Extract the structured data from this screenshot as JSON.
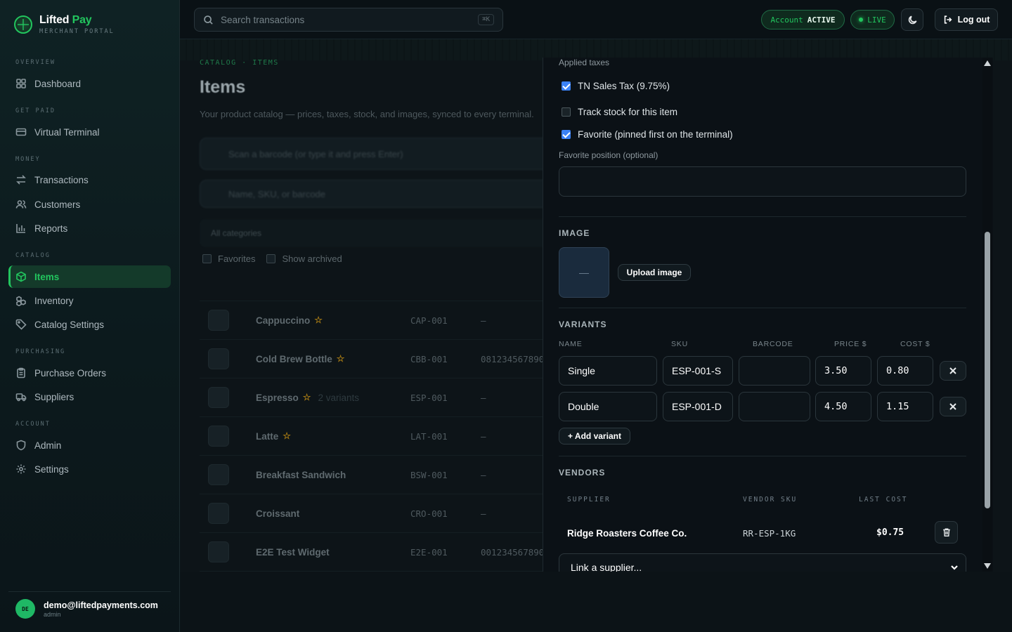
{
  "brand": {
    "name_a": "Lifted",
    "name_b": "Pay",
    "subtitle": "MERCHANT PORTAL"
  },
  "nav": {
    "overview_label": "OVERVIEW",
    "dashboard": "Dashboard",
    "getpaid_label": "GET PAID",
    "virtual_terminal": "Virtual Terminal",
    "money_label": "MONEY",
    "transactions": "Transactions",
    "customers": "Customers",
    "reports": "Reports",
    "catalog_label": "CATALOG",
    "items": "Items",
    "inventory": "Inventory",
    "catalog_settings": "Catalog Settings",
    "purchasing_label": "PURCHASING",
    "purchase_orders": "Purchase Orders",
    "suppliers": "Suppliers",
    "account_label": "ACCOUNT",
    "admin": "Admin",
    "settings": "Settings"
  },
  "user": {
    "initials": "DE",
    "email": "demo@liftedpayments.com",
    "role": "admin"
  },
  "topbar": {
    "search_placeholder": "Search transactions",
    "search_shortcut": "⌘K",
    "account_prefix": "Account",
    "account_status": "ACTIVE",
    "live_label": "LIVE",
    "logout_label": "Log out"
  },
  "page": {
    "breadcrumb": "CATALOG · ITEMS",
    "title": "Items",
    "description": "Your product catalog — prices, taxes, stock, and images, synced to every terminal.",
    "scan_placeholder": "Scan a barcode (or type it and press Enter)",
    "filter_placeholder": "Name, SKU, or barcode",
    "category_filter": "All categories",
    "favorites_label": "Favorites",
    "archived_label": "Show archived",
    "items": [
      {
        "name": "Cappuccino",
        "star": true,
        "variants": "",
        "sku": "CAP-001",
        "barcode": "—"
      },
      {
        "name": "Cold Brew Bottle",
        "star": true,
        "variants": "",
        "sku": "CBB-001",
        "barcode": "081234567890"
      },
      {
        "name": "Espresso",
        "star": true,
        "variants": "2 variants",
        "sku": "ESP-001",
        "barcode": "—"
      },
      {
        "name": "Latte",
        "star": true,
        "variants": "",
        "sku": "LAT-001",
        "barcode": "—"
      },
      {
        "name": "Breakfast Sandwich",
        "star": false,
        "variants": "",
        "sku": "BSW-001",
        "barcode": "—"
      },
      {
        "name": "Croissant",
        "star": false,
        "variants": "",
        "sku": "CRO-001",
        "barcode": "—"
      },
      {
        "name": "E2E Test Widget",
        "star": false,
        "variants": "",
        "sku": "E2E-001",
        "barcode": "001234567890"
      }
    ]
  },
  "drawer": {
    "applied_taxes_label": "Applied taxes",
    "tax_option": "TN Sales Tax (9.75%)",
    "tax_checked": true,
    "track_stock_label": "Track stock for this item",
    "track_stock_checked": false,
    "favorite_label": "Favorite (pinned first on the terminal)",
    "favorite_checked": true,
    "favorite_position_label": "Favorite position (optional)",
    "favorite_position_value": "",
    "image_heading": "IMAGE",
    "image_placeholder": "—",
    "upload_label": "Upload image",
    "variants_heading": "VARIANTS",
    "variant_columns": {
      "name": "NAME",
      "sku": "SKU",
      "barcode": "BARCODE",
      "price": "PRICE $",
      "cost": "COST $"
    },
    "variants": [
      {
        "name": "Single",
        "sku": "ESP-001-S",
        "barcode": "",
        "price": "3.50",
        "cost": "0.80"
      },
      {
        "name": "Double",
        "sku": "ESP-001-D",
        "barcode": "",
        "price": "4.50",
        "cost": "1.15"
      }
    ],
    "add_variant_label": "+ Add variant",
    "vendors_heading": "VENDORS",
    "vendor_columns": {
      "supplier": "SUPPLIER",
      "vendor_sku": "VENDOR SKU",
      "last_cost": "LAST COST"
    },
    "vendors": [
      {
        "supplier": "Ridge Roasters Coffee Co.",
        "vendor_sku": "RR-ESP-1KG",
        "last_cost": "$0.75"
      }
    ],
    "link_supplier_label": "Link a supplier..."
  },
  "colors": {
    "accent": "#22c55e",
    "checkbox": "#3b82f6",
    "star": "#a67a14"
  }
}
